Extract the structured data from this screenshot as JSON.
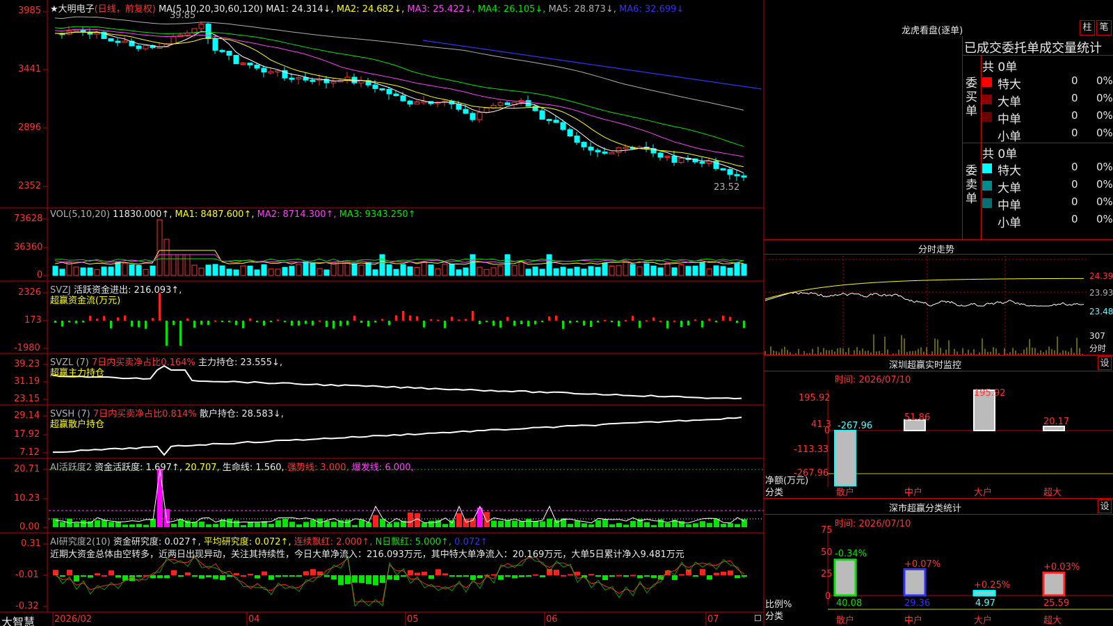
{
  "main": {
    "stock_name": "★大明电子",
    "period": "(日线，前复权)",
    "ma_label": "MA(5,10,20,30,60,120)",
    "ma1": "MA1: 24.314↓,",
    "ma2": "MA2: 24.682↓,",
    "ma3": "MA3: 25.422↓,",
    "ma4": "MA4: 26.105↓,",
    "ma5": "MA5: 28.873↓,",
    "ma6": "MA6: 32.699↓",
    "yticks": [
      "3985",
      "3441",
      "2896",
      "2352"
    ],
    "high_label": "39.85",
    "low_label": "23.52"
  },
  "vol": {
    "label": "VOL(5,10,20)",
    "value": "11830.000↑,",
    "ma1": "MA1: 8487.600↑,",
    "ma2": "MA2: 8714.300↑,",
    "ma3": "MA3: 9343.250↑",
    "yticks": [
      "73628",
      "36360",
      "0"
    ]
  },
  "svzj": {
    "label": "SVZJ",
    "desc": "活跃资金进出: 216.093↑,",
    "sub": "超赢资金流(万元)",
    "yticks": [
      "2326",
      "173",
      "-1980"
    ]
  },
  "svzl": {
    "label": "SVZL (7)",
    "desc1": "7日内买卖净占比0.164%",
    "desc2": "主力持仓: 23.555↓,",
    "sub": "超赢主力持仓",
    "yticks": [
      "39.23",
      "31.19",
      "23.15"
    ]
  },
  "svsh": {
    "label": "SVSH (7)",
    "desc1": "7日内买卖净占比0.814%",
    "desc2": "散户持仓: 28.583↓,",
    "sub": "超赢散户持仓",
    "yticks": [
      "29.14",
      "17.92",
      "7.12"
    ]
  },
  "ai1": {
    "label": "AI活跃度2",
    "v1": "资金活跃度: 1.697↑,",
    "v2": "20.707,",
    "v3": "生命线: 1.560,",
    "v4": "强势线: 3.000,",
    "v5": "爆发线: 6.000,",
    "yticks": [
      "20.71",
      "10.23",
      "0.00"
    ]
  },
  "ai2": {
    "label": "AI研究度2(10)",
    "v1": "资金研究度: 0.027↑,",
    "v2": "平均研究度: 0.072↑,",
    "v3": "连续飘红: 2.000↑,",
    "v4": "N日飘红: 5.000↑,",
    "v5": "0.072↑",
    "comment": "近期大资金总体由空转多，近两日出现异动，关注其持续性，今日大单净流入：216.093万元，其中特大单净流入：20.169万元，大单5日累计净入9.481万元",
    "yticks": [
      "0.31",
      "-0.01",
      "-0.32"
    ]
  },
  "bottom": {
    "brand": "大智慧",
    "dates": [
      "2026/02",
      "04",
      "05",
      "06",
      "07"
    ]
  },
  "right": {
    "dragon_title": "龙虎看盘(逐单)",
    "btn_zhu": "柱",
    "btn_bi": "笔",
    "stats_title": "已成交委托单成交量统计",
    "buy_side": "委买单",
    "sell_side": "委卖单",
    "buy_total": "共 0单",
    "sell_total": "共 0单",
    "rows": [
      {
        "label": "特大",
        "count": "0",
        "pct": "0%"
      },
      {
        "label": "大单",
        "count": "0",
        "pct": "0%"
      },
      {
        "label": "中单",
        "count": "0",
        "pct": "0%"
      },
      {
        "label": "小单",
        "count": "0",
        "pct": "0%"
      }
    ],
    "buy_colors": [
      "#ff0000",
      "#8b0000",
      "#6a0000",
      "#000000"
    ],
    "sell_colors": [
      "#00ffff",
      "#008b8b",
      "#007070",
      "#000000"
    ],
    "intraday_title": "分时走势",
    "intraday_yticks": [
      "24.39",
      "23.93",
      "23.48"
    ],
    "intraday_vol": "307",
    "intraday_vol_unit": "分时",
    "monitor_title": "深圳超赢实时监控",
    "monitor_time": "时间: 2026/07/10",
    "set_label": "设",
    "monitor_yticks": [
      "195.92",
      "41.3",
      "0",
      "-113.33",
      "-267.96"
    ],
    "monitor_unit1": "净额(万元)",
    "monitor_unit2": "分类",
    "monitor_values": [
      "-267.96",
      "51.86",
      "195.92",
      "20.17"
    ],
    "monitor_cats": [
      "散户",
      "中户",
      "大户",
      "超大"
    ],
    "class_title": "深市超赢分类统计",
    "class_time": "时间: 2026/07/10",
    "class_yticks": [
      "75",
      "50",
      "25",
      "0"
    ],
    "class_unit1": "比例%",
    "class_unit2": "分类",
    "class_changes": [
      "-0.34%",
      "+0.07%",
      "+0.25%",
      "+0.03%"
    ],
    "class_values": [
      "40.08",
      "29.36",
      "4.97",
      "25.59"
    ],
    "class_cats": [
      "散户",
      "中户",
      "大户",
      "超大"
    ]
  }
}
